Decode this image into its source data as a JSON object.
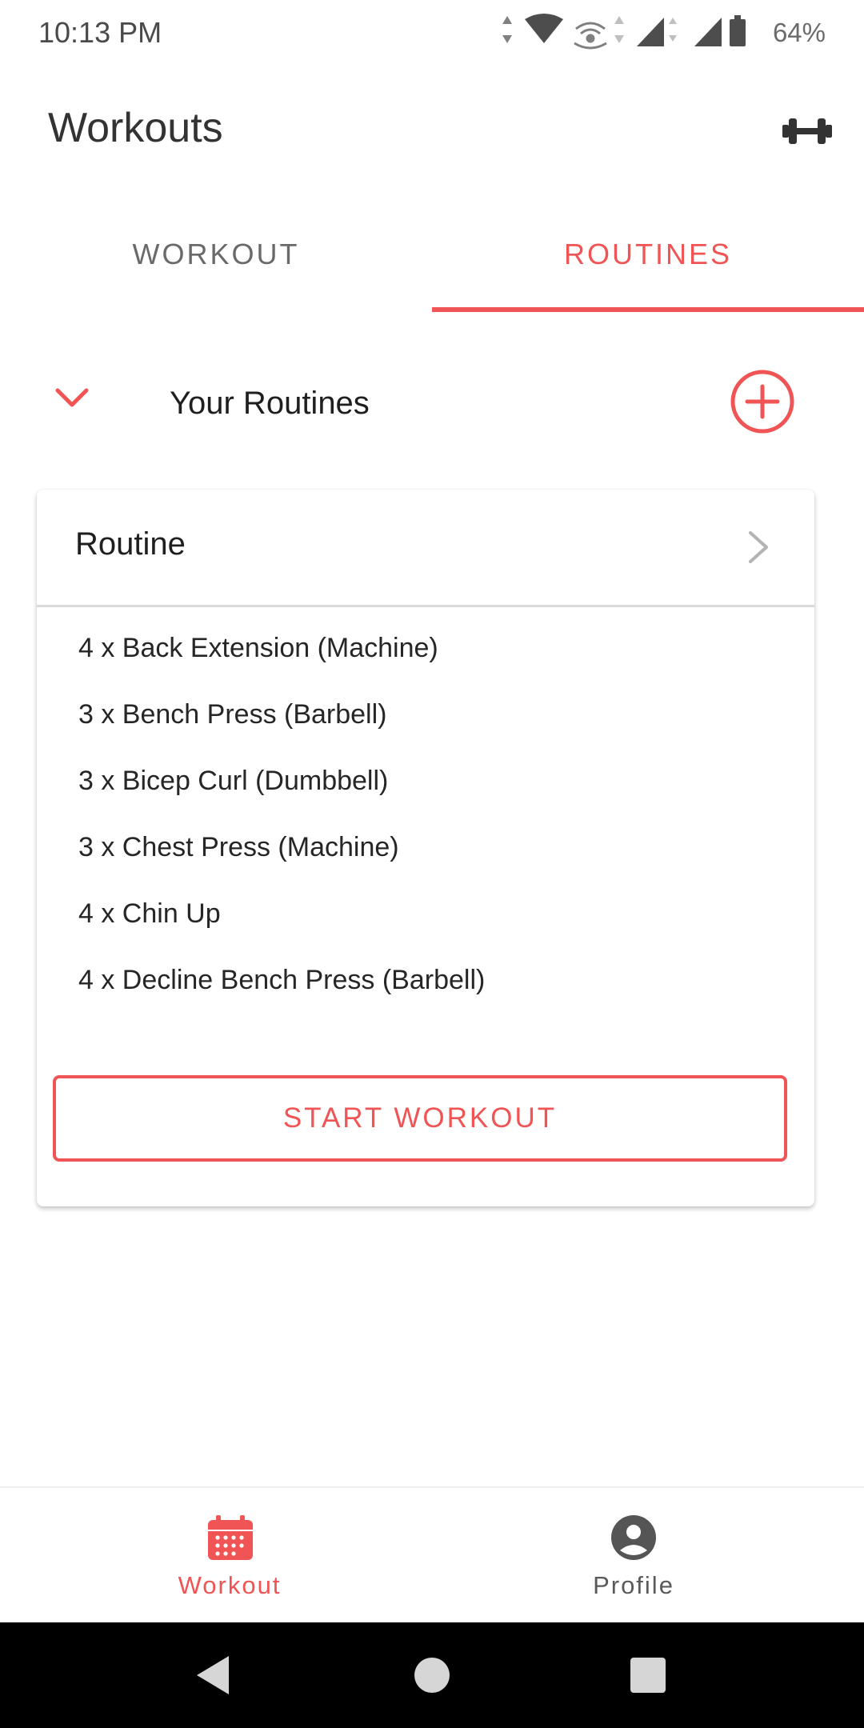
{
  "status_bar": {
    "time": "10:13 PM",
    "battery": "64%",
    "icons": [
      "data-arrows-icon",
      "wifi-icon",
      "hotspot-icon",
      "signal-icon",
      "signal-icon",
      "battery-icon"
    ]
  },
  "app_bar": {
    "title": "Workouts",
    "action_icon": "dumbbell-icon"
  },
  "tabs": [
    {
      "label": "WORKOUT",
      "selected": false
    },
    {
      "label": "ROUTINES",
      "selected": true
    }
  ],
  "section": {
    "title": "Your Routines",
    "expanded": true,
    "toggle_icon": "chevron-down-icon",
    "add_icon": "plus-circle-icon"
  },
  "routine_card": {
    "title": "Routine",
    "exercises": [
      "4 x Back Extension (Machine)",
      "3 x Bench Press (Barbell)",
      "3 x Bicep Curl (Dumbbell)",
      "3 x Chest Press (Machine)",
      "4 x Chin Up",
      "4 x Decline Bench Press (Barbell)"
    ],
    "start_label": "START WORKOUT"
  },
  "bottom_nav": [
    {
      "label": "Workout",
      "icon": "calendar-icon",
      "active": true
    },
    {
      "label": "Profile",
      "icon": "account-icon",
      "active": false
    }
  ],
  "colors": {
    "accent": "#f05454",
    "text_primary": "#1f1f1f",
    "text_secondary": "#6a6a6a",
    "background": "#ffffff",
    "system_nav": "#000000"
  }
}
